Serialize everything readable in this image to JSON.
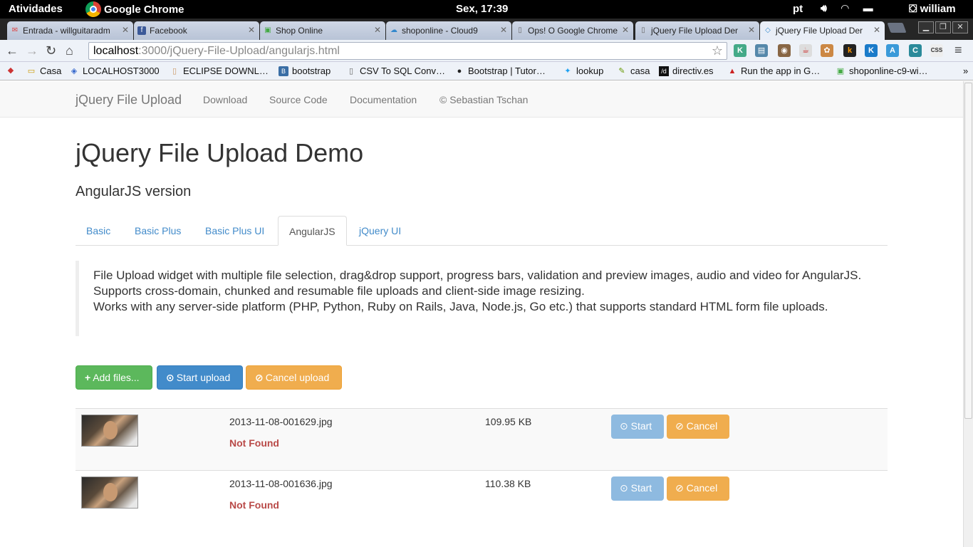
{
  "system": {
    "activities": "Atividades",
    "app_name": "Google Chrome",
    "clock": "Sex, 17:39",
    "lang": "pt",
    "user": "william"
  },
  "tabs": [
    {
      "title": "Entrada - willguitaradm",
      "icon": "gmail-icon"
    },
    {
      "title": "Facebook",
      "icon": "facebook-icon"
    },
    {
      "title": "Shop Online",
      "icon": "shop-icon"
    },
    {
      "title": "shoponline - Cloud9",
      "icon": "cloud9-icon"
    },
    {
      "title": "Ops! O Google Chrome",
      "icon": "page-icon"
    },
    {
      "title": "jQuery File Upload Der",
      "icon": "page-icon"
    },
    {
      "title": "jQuery File Upload Der",
      "icon": "angular-icon",
      "active": true
    }
  ],
  "address_bar": {
    "host": "localhost",
    "path": ":3000/jQuery-File-Upload/angularjs.html"
  },
  "bookmarks": [
    {
      "label": "",
      "icon": "incognito-icon"
    },
    {
      "label": "Casa",
      "icon": "folder-icon"
    },
    {
      "label": "LOCALHOST3000",
      "icon": "diamond-icon"
    },
    {
      "label": "ECLIPSE DOWNL…",
      "icon": "page-icon"
    },
    {
      "label": "bootstrap",
      "icon": "bootstrap-icon"
    },
    {
      "label": "CSV To SQL Conv…",
      "icon": "page-icon"
    },
    {
      "label": "Bootstrap | Tutor…",
      "icon": "github-icon"
    },
    {
      "label": "lookup",
      "icon": "twitter-icon"
    },
    {
      "label": "casa",
      "icon": "tool-icon"
    },
    {
      "label": "directiv.es",
      "icon": "directives-icon"
    },
    {
      "label": "Run the app in G…",
      "icon": "ruby-icon"
    },
    {
      "label": "shoponline-c9-wi…",
      "icon": "shop-icon"
    }
  ],
  "navbar": {
    "brand": "jQuery File Upload",
    "links": [
      "Download",
      "Source Code",
      "Documentation",
      "© Sebastian Tschan"
    ]
  },
  "heading": "jQuery File Upload Demo",
  "subheading": "AngularJS version",
  "demo_tabs": [
    "Basic",
    "Basic Plus",
    "Basic Plus UI",
    "AngularJS",
    "jQuery UI"
  ],
  "active_demo_tab": "AngularJS",
  "description": [
    "File Upload widget with multiple file selection, drag&drop support, progress bars, validation and preview images, audio and video for AngularJS.",
    "Supports cross-domain, chunked and resumable file uploads and client-side image resizing.",
    "Works with any server-side platform (PHP, Python, Ruby on Rails, Java, Node.js, Go etc.) that supports standard HTML form file uploads."
  ],
  "actions": {
    "add": "Add files...",
    "start": "Start upload",
    "cancel": "Cancel upload"
  },
  "files": [
    {
      "name": "2013-11-08-001629.jpg",
      "size": "109.95 KB",
      "error": "Not Found",
      "start": "Start",
      "cancel": "Cancel"
    },
    {
      "name": "2013-11-08-001636.jpg",
      "size": "110.38 KB",
      "error": "Not Found",
      "start": "Start",
      "cancel": "Cancel"
    }
  ],
  "colors": {
    "success": "#5cb85c",
    "primary": "#428bca",
    "warning": "#f0ad4e",
    "error_text": "#b94a48",
    "link": "#428bca"
  }
}
